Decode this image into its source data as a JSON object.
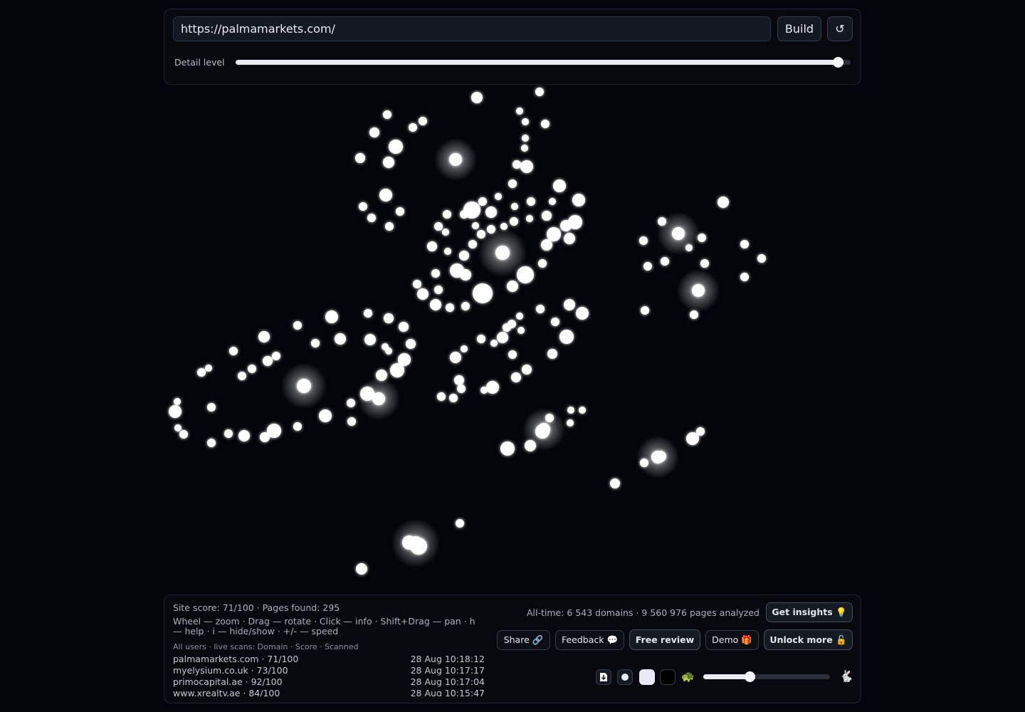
{
  "url_input": {
    "value": "https://palmamarkets.com/"
  },
  "top": {
    "build_label": "Build",
    "refresh_icon": "refresh-icon",
    "refresh_glyph": "↺",
    "detail_label": "Detail level",
    "detail_value": 0.98
  },
  "stats": {
    "site_score": "Site score: 71/100 · Pages found: 295",
    "help": "Wheel — zoom · Drag — rotate · Click — info · Shift+Drag — pan · h — help · i — hide/show · +/- — speed",
    "scans_header": "All users · live scans: Domain · Score · Scanned",
    "alltime": "All-time: 6 543 domains · 9 560 976 pages analyzed"
  },
  "scans": [
    {
      "domain": "palmamarkets.com · 71/100",
      "time": "28 Aug 10:18:12"
    },
    {
      "domain": "myelysium.co.uk · 73/100",
      "time": "28 Aug 10:17:17"
    },
    {
      "domain": "primocapital.ae · 92/100",
      "time": "28 Aug 10:17:04"
    },
    {
      "domain": "www.xrealty.ae · 84/100",
      "time": "28 Aug 10:15:47"
    }
  ],
  "actions": {
    "insights": "Get insights 💡",
    "share": "Share 🔗",
    "feedback": "Feedback 💬",
    "review": "Free review",
    "demo": "Demo 🎁",
    "unlock": "Unlock more 🔓"
  },
  "controls": {
    "download_icon": "download-icon",
    "dot_icon": "dot-icon",
    "turtle": "🐢",
    "rabbit": "🐇",
    "speed_value": 0.37
  },
  "colors": {
    "background": "#04050a",
    "node": "#ffffff",
    "glow": "#cfd6ff"
  }
}
